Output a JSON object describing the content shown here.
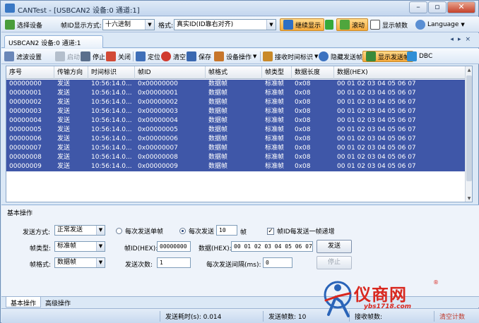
{
  "window": {
    "title": "CANTest - [USBCAN2 设备:0 通道:1]",
    "buttons": {
      "minimize": "–",
      "maximize": "▫",
      "close": "✕"
    }
  },
  "toolbar1": {
    "select_device": "选择设备",
    "id_mode_label": "帧ID显示方式:",
    "id_mode_value": "十六进制",
    "format_label": "格式:",
    "format_value": "真实ID(ID靠右对齐)",
    "continue_display": "继续显示",
    "scroll": "滚动",
    "show_frame_count": "显示帧数",
    "language": "Language"
  },
  "doc_tab": {
    "label": "USBCAN2 设备:0 通道:1",
    "close": "×",
    "nav": "◂▸×"
  },
  "toolbar2": {
    "filter": "滤波设置",
    "start": "启动",
    "stop": "停止",
    "close": "关闭",
    "locate": "定位",
    "clear": "清空",
    "save": "保存",
    "device_op": "设备操作",
    "recv_time": "接收时间标识",
    "hide_sent": "隐藏发送帧",
    "show_sent": "显示发送帧",
    "dbc": "DBC"
  },
  "grid": {
    "headers": [
      "序号",
      "传输方向",
      "时间标识",
      "帧ID",
      "帧格式",
      "帧类型",
      "数据长度",
      "数据(HEX)"
    ],
    "rows": [
      [
        "00000000",
        "发送",
        "10:56:14.0...",
        "0x00000000",
        "数据帧",
        "标准帧",
        "0x08",
        "00 01 02 03 04 05 06 07"
      ],
      [
        "00000001",
        "发送",
        "10:56:14.0...",
        "0x00000001",
        "数据帧",
        "标准帧",
        "0x08",
        "00 01 02 03 04 05 06 07"
      ],
      [
        "00000002",
        "发送",
        "10:56:14.0...",
        "0x00000002",
        "数据帧",
        "标准帧",
        "0x08",
        "00 01 02 03 04 05 06 07"
      ],
      [
        "00000003",
        "发送",
        "10:56:14.0...",
        "0x00000003",
        "数据帧",
        "标准帧",
        "0x08",
        "00 01 02 03 04 05 06 07"
      ],
      [
        "00000004",
        "发送",
        "10:56:14.0...",
        "0x00000004",
        "数据帧",
        "标准帧",
        "0x08",
        "00 01 02 03 04 05 06 07"
      ],
      [
        "00000005",
        "发送",
        "10:56:14.0...",
        "0x00000005",
        "数据帧",
        "标准帧",
        "0x08",
        "00 01 02 03 04 05 06 07"
      ],
      [
        "00000006",
        "发送",
        "10:56:14.0...",
        "0x00000006",
        "数据帧",
        "标准帧",
        "0x08",
        "00 01 02 03 04 05 06 07"
      ],
      [
        "00000007",
        "发送",
        "10:56:14.0...",
        "0x00000007",
        "数据帧",
        "标准帧",
        "0x08",
        "00 01 02 03 04 05 06 07"
      ],
      [
        "00000008",
        "发送",
        "10:56:14.0...",
        "0x00000008",
        "数据帧",
        "标准帧",
        "0x08",
        "00 01 02 03 04 05 06 07"
      ],
      [
        "00000009",
        "发送",
        "10:56:14.0...",
        "0x00000009",
        "数据帧",
        "标准帧",
        "0x08",
        "00 01 02 03 04 05 06 07"
      ]
    ]
  },
  "panel": {
    "title": "基本操作",
    "send_mode_label": "发送方式:",
    "send_mode_value": "正常发送",
    "single_send": "每次发送单帧",
    "each_send": "每次发送",
    "each_send_count": "10",
    "frame_unit": "帧",
    "id_increment": "帧ID每发送一帧递增",
    "frame_type_label": "帧类型:",
    "frame_type_value": "标准帧",
    "frame_id_label": "帧ID(HEX):",
    "frame_id_value": "00000000",
    "data_label": "数据(HEX):",
    "data_value": "00 01 02 03 04 05 06 07",
    "send_btn": "发送",
    "frame_format_label": "帧格式:",
    "frame_format_value": "数据帧",
    "send_times_label": "发送次数:",
    "send_times_value": "1",
    "interval_label": "每次发送间隔(ms):",
    "interval_value": "0",
    "stop_btn": "停止"
  },
  "bottom_tabs": [
    "基本操作",
    "高级操作"
  ],
  "statusbar": {
    "send_time": "发送耗时(s):  0.014",
    "send_count": "发送帧数:  10",
    "recv_count": "接收帧数:",
    "clear_count": "清空计数"
  },
  "watermark": {
    "brand": "仪商网",
    "reg": "®",
    "url": "ybs1718.com"
  },
  "colors": {
    "selection": "#3f57a8",
    "accent": "#f5a93b",
    "brand_red": "#d9281f"
  }
}
